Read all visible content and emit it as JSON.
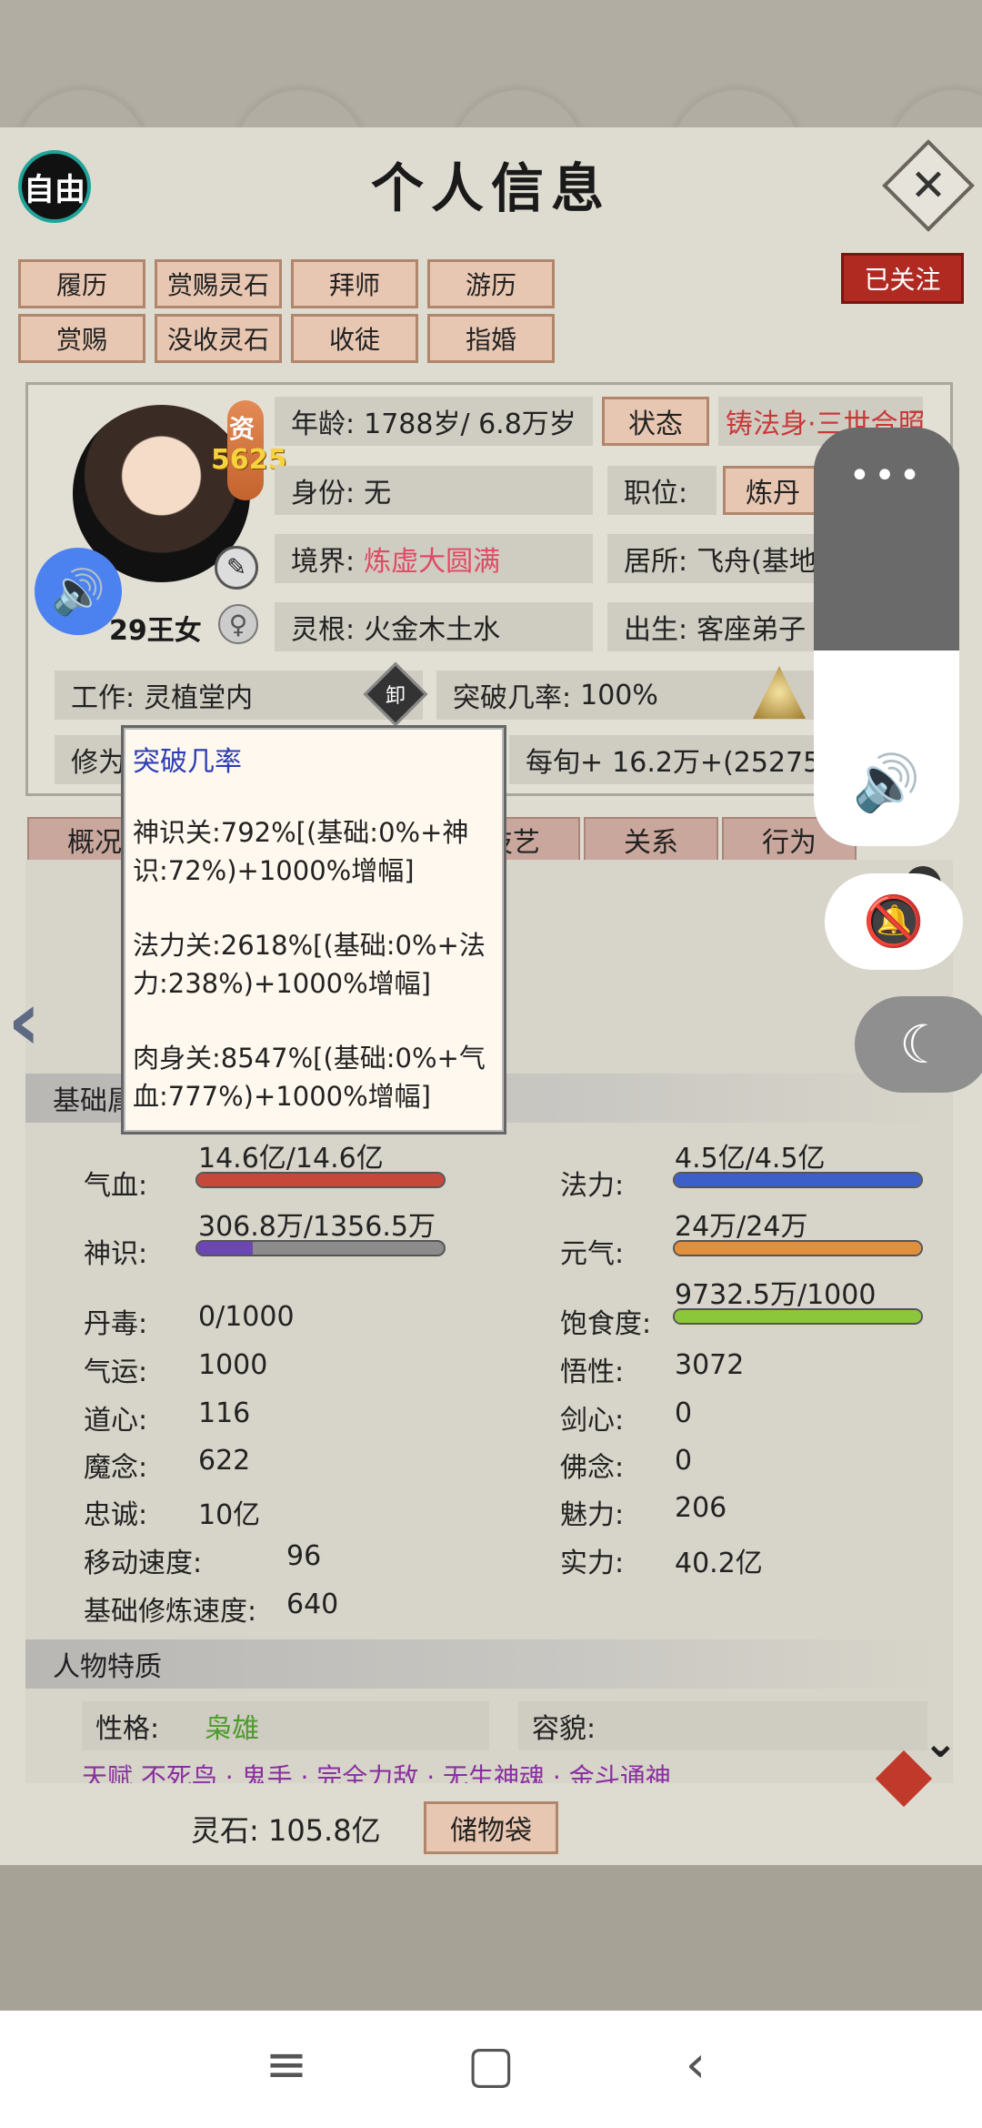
{
  "header": {
    "title": "个人信息",
    "free_label": "自由",
    "close_symbol": "✕",
    "follow_label": "已关注"
  },
  "actions": [
    "履历",
    "赏赐灵石",
    "拜师",
    "游历",
    "赏赐",
    "没收灵石",
    "收徒",
    "指婚"
  ],
  "profile": {
    "aptitude_label": "资",
    "aptitude_value": "5625",
    "name": "29王女",
    "age_label": "年龄:",
    "age_value": "1788岁/ 6.8万岁",
    "status_button": "状态",
    "title_text": "铸法身·三世合照",
    "identity_label": "身份:",
    "identity_value": "无",
    "post_label": "职位:",
    "post_button": "炼丹",
    "realm_label": "境界:",
    "realm_value": "炼虚大圆满",
    "residence_label": "居所:",
    "residence_value": "飞舟(基地",
    "root_label": "灵根:",
    "root_value": "火金木土水",
    "birth_label": "出生:",
    "birth_value": "客座弟子",
    "job_label": "工作:",
    "job_value": "灵植堂内",
    "job_badge": "卸",
    "break_label": "突破几率:",
    "break_value": "100%",
    "break_badge": "突破",
    "cultivate_label": "修为",
    "per_turn_label": "每旬+",
    "per_turn_value": "16.2万+(25275"
  },
  "tabs": [
    "概况",
    "技艺",
    "关系",
    "行为"
  ],
  "basic_section": "基础属性",
  "stats": {
    "blood_label": "气血:",
    "blood_value": "14.6亿/14.6亿",
    "blood_fill": 1.0,
    "mana_label": "法力:",
    "mana_value": "4.5亿/4.5亿",
    "mana_fill": 1.0,
    "sense_label": "神识:",
    "sense_value": "306.8万/1356.5万",
    "sense_fill": 0.226,
    "qi_label": "元气:",
    "qi_value": "24万/24万",
    "qi_fill": 1.0,
    "poison_label": "丹毒:",
    "poison_value": "0/1000",
    "satiety_label": "饱食度:",
    "satiety_value": "9732.5万/1000",
    "satiety_fill": 1.0,
    "luck_label": "气运:",
    "luck_value": "1000",
    "wisdom_label": "悟性:",
    "wisdom_value": "3072",
    "dao_label": "道心:",
    "dao_value": "116",
    "sword_label": "剑心:",
    "sword_value": "0",
    "demon_label": "魔念:",
    "demon_value": "622",
    "buddha_label": "佛念:",
    "buddha_value": "0",
    "loyal_label": "忠诚:",
    "loyal_value": "10亿",
    "charm_label": "魅力:",
    "charm_value": "206",
    "move_label": "移动速度:",
    "move_value": "96",
    "power_label": "实力:",
    "power_value": "40.2亿",
    "base_cult_label": "基础修炼速度:",
    "base_cult_value": "640"
  },
  "traits_section": "人物特质",
  "traits": {
    "personality_label": "性格:",
    "personality_value": "枭雄",
    "looks_label": "容貌:",
    "talent_peek": "天赋  不死鸟  ·  鬼手  ·  完全力敌  ·  无生神魂  ·  金斗通神"
  },
  "footer": {
    "spirit_stone": "灵石: 105.8亿",
    "storage_button": "储物袋"
  },
  "tooltip": {
    "title": "突破几率",
    "lines": [
      "神识关:792%[(基础:0%+神识:72%)+1000%增幅]",
      "法力关:2618%[(基础:0%+法力:238%)+1000%增幅]",
      "肉身关:8547%[(基础:0%+气血:777%)+1000%增幅]"
    ]
  },
  "overlay": {
    "dots": "•••"
  },
  "colors": {
    "blood": "#c6483a",
    "mana": "#3d5fc9",
    "sense": "#6b46b4",
    "qi": "#e28f3b",
    "satiety": "#8cc63a"
  }
}
